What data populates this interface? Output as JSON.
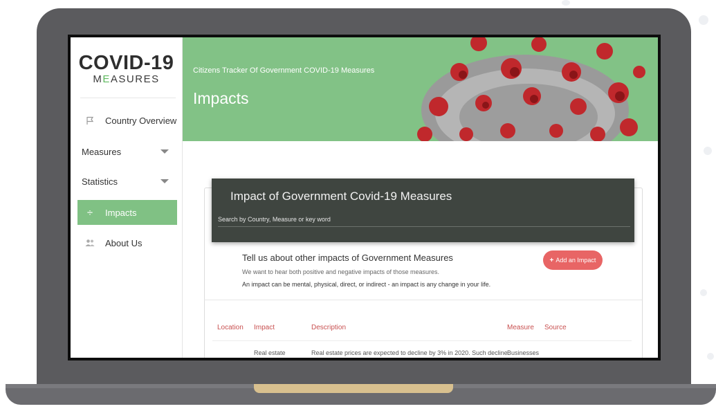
{
  "sidebar": {
    "logo_main": "COVID-19",
    "logo_sub_a": "M",
    "logo_sub_accent": "E",
    "logo_sub_b": "ASURES",
    "items": [
      {
        "label": "Country Overview",
        "icon": "flag-icon"
      },
      {
        "label": "Measures",
        "icon": "chevron-down-icon"
      },
      {
        "label": "Statistics",
        "icon": "chevron-down-icon"
      },
      {
        "label": "Impacts",
        "icon": "divide-icon",
        "active": true
      },
      {
        "label": "About Us",
        "icon": "users-icon"
      }
    ]
  },
  "banner": {
    "tagline": "Citizens Tracker Of Government COVID-19 Measures",
    "title": "Impacts"
  },
  "panel": {
    "title": "Impact of Government Covid-19 Measures",
    "search_placeholder": "Search by Country, Measure or key word"
  },
  "tell": {
    "title": "Tell us about other impacts of Government Measures",
    "line1": "We want to hear both positive and negative impacts of those measures.",
    "line2": "An impact can be mental, physical, direct, or indirect - an impact is any change in your life.",
    "button_label": "Add an Impact"
  },
  "table": {
    "headers": [
      "Location",
      "Impact",
      "Description",
      "Measure",
      "Source"
    ],
    "rows": [
      {
        "impact": "Real estate",
        "description": "Real estate prices are expected to decline by 3% in 2020. Such decline",
        "measure": "Businesses"
      }
    ]
  },
  "colors": {
    "accent_green": "#82c286",
    "button_red": "#e86565",
    "header_red": "#c85050",
    "panel_dark": "#3f4540"
  }
}
